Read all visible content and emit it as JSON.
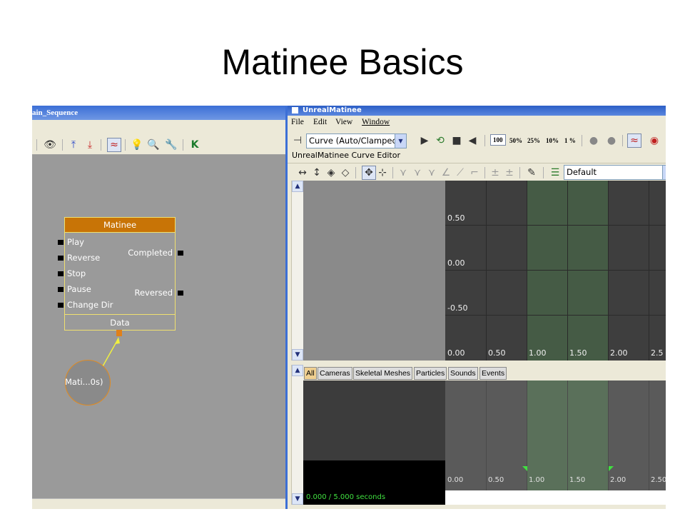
{
  "slide_title": "Matinee  Basics",
  "kismet": {
    "window_title": "ain_Sequence",
    "toolbar_icons": [
      "eye-icon",
      "move-up-icon",
      "move-down-icon",
      "curve-editor-icon",
      "bulb-icon",
      "search-icon",
      "wrench-icon",
      "k-icon"
    ],
    "node": {
      "title": "Matinee",
      "inputs": [
        "Play",
        "Reverse",
        "Stop",
        "Pause",
        "Change Dir"
      ],
      "outputs": [
        "Completed",
        "Reversed"
      ],
      "data_label": "Data"
    },
    "variable_label": "Mati...0s)"
  },
  "matinee": {
    "window_title": "UnrealMatinee",
    "menu": [
      "File",
      "Edit",
      "View",
      "Window"
    ],
    "interp_mode": "Curve (Auto/Clampec",
    "zoom_levels": [
      "100",
      "50%",
      "25%",
      "10%",
      "1 %"
    ],
    "caption": "UnrealMatinee Curve Editor",
    "preset": "Default",
    "curve_y_labels": [
      "0.50",
      "0.00",
      "-0.50"
    ],
    "curve_x_labels": [
      "0.00",
      "0.50",
      "1.00",
      "1.50",
      "2.00",
      "2.5"
    ],
    "tabs": [
      "All",
      "Cameras",
      "Skeletal Meshes",
      "Particles",
      "Sounds",
      "Events"
    ],
    "timeline_labels": [
      "0.00",
      "0.50",
      "1.00",
      "1.50",
      "2.00",
      "2.50"
    ],
    "status": "0.000 / 5.000 seconds"
  },
  "colors": {
    "node_title": "#c87406",
    "node_border": "#f0e070",
    "section_highlight": "#5aaa5a",
    "status_text": "#40e040"
  }
}
